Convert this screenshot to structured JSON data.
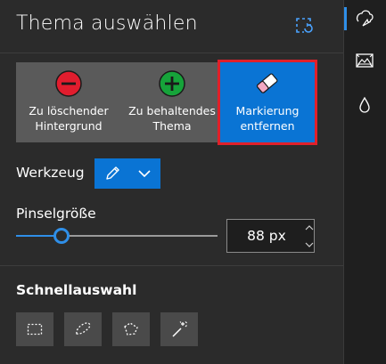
{
  "panel": {
    "title": "Thema auswählen",
    "header_button_icon": "select-region-icon"
  },
  "tiles": {
    "background": {
      "label": "Zu löschender Hintergrund",
      "line1": "Zu löschender",
      "line2": "Hintergrund",
      "icon": "minus-circle-icon",
      "color": "#e11d2e"
    },
    "keep": {
      "label": "Zu behaltendes Thema",
      "line1": "Zu behaltendes",
      "line2": "Thema",
      "icon": "plus-circle-icon",
      "color": "#16a33a"
    },
    "erase": {
      "label": "Markierung entfernen",
      "line1": "Markierung",
      "line2": "entfernen",
      "icon": "eraser-icon",
      "selected": true
    }
  },
  "tool": {
    "label": "Werkzeug",
    "selected_icon": "pen-icon"
  },
  "brush_size": {
    "label": "Pinselgröße",
    "value_text": "88 px",
    "slider_fraction": 0.2
  },
  "quick_select": {
    "label": "Schnellauswahl",
    "tools": [
      "rectangle-select-icon",
      "lasso-select-icon",
      "polygon-lasso-icon",
      "magic-wand-icon"
    ]
  },
  "rail": {
    "items": [
      "magic-select-icon",
      "image-frame-icon",
      "water-drop-icon"
    ],
    "active_index": 0
  },
  "colors": {
    "accent": "#0a74d4",
    "highlight": "#e0202a",
    "panel_bg": "#2b2b2b"
  }
}
